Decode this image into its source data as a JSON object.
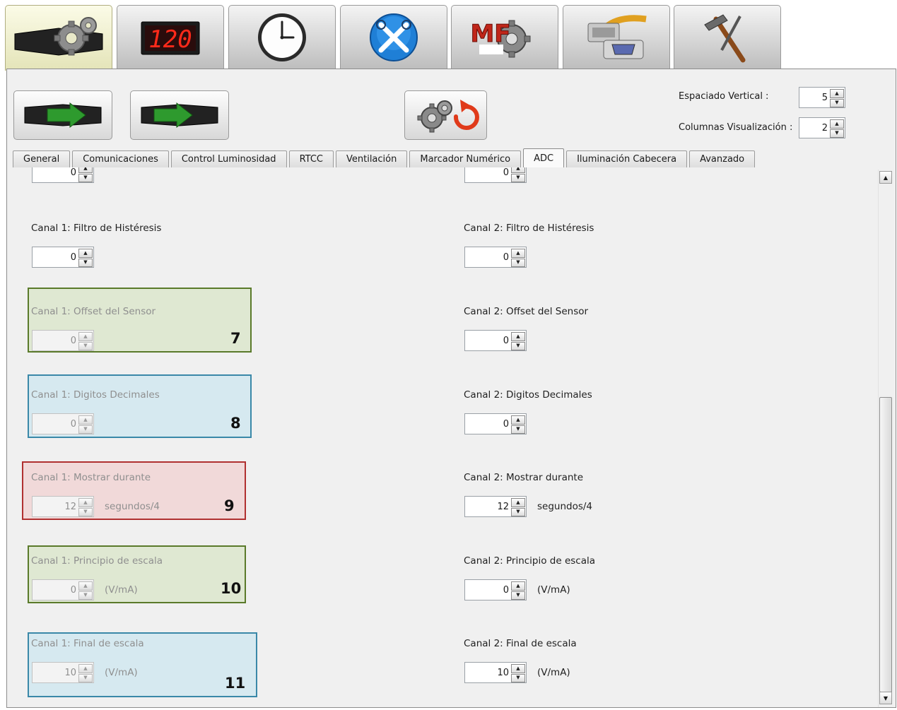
{
  "top_tabs": [
    {
      "name": "display-config",
      "icon": "led-display-gears-icon",
      "active": true
    },
    {
      "name": "numeric-display",
      "icon": "led-counter-icon",
      "readout": "120",
      "active": false
    },
    {
      "name": "clock",
      "icon": "clock-icon",
      "active": false
    },
    {
      "name": "tools",
      "icon": "tools-globe-icon",
      "active": false
    },
    {
      "name": "mf-tools",
      "icon": "mf-tools-icon",
      "readout": "MF",
      "active": false
    },
    {
      "name": "connection",
      "icon": "serial-cable-icon",
      "active": false
    },
    {
      "name": "hammer",
      "icon": "hammer-icon",
      "active": false
    }
  ],
  "toolbar": {
    "buttons": [
      {
        "name": "read-from-device",
        "icon": "display-left-arrow-icon"
      },
      {
        "name": "write-to-device",
        "icon": "display-right-arrow-icon"
      },
      {
        "name": "reset-settings",
        "icon": "gear-reset-icon"
      }
    ],
    "espaciado_vertical": {
      "label": "Espaciado Vertical :",
      "value": "5"
    },
    "columnas_visualizacion": {
      "label": "Columnas Visualización :",
      "value": "2"
    }
  },
  "tabs": [
    {
      "label": "General",
      "active": false
    },
    {
      "label": "Comunicaciones",
      "active": false
    },
    {
      "label": "Control Luminosidad",
      "active": false
    },
    {
      "label": "RTCC",
      "active": false
    },
    {
      "label": "Ventilación",
      "active": false
    },
    {
      "label": "Marcador Numérico",
      "active": false
    },
    {
      "label": "ADC",
      "active": true
    },
    {
      "label": "Iluminación Cabecera",
      "active": false
    },
    {
      "label": "Avanzado",
      "active": false
    }
  ],
  "adc": {
    "top_partial": {
      "c1_value": "0",
      "c2_value": "0"
    },
    "rows": [
      {
        "c1_label": "Canal 1: Filtro de Histéresis",
        "c1_value": "0",
        "c2_label": "Canal 2: Filtro de Histéresis",
        "c2_value": "0",
        "unit": ""
      },
      {
        "c1_label": "Canal 1: Offset del Sensor",
        "c1_value": "0",
        "c2_label": "Canal 2: Offset del Sensor",
        "c2_value": "0",
        "unit": "",
        "badge": "7"
      },
      {
        "c1_label": "Canal 1: Digitos Decimales",
        "c1_value": "0",
        "c2_label": "Canal 2: Digitos Decimales",
        "c2_value": "0",
        "unit": "",
        "badge": "8"
      },
      {
        "c1_label": "Canal 1: Mostrar durante",
        "c1_value": "12",
        "c2_label": "Canal 2: Mostrar durante",
        "c2_value": "12",
        "unit": "segundos/4",
        "badge": "9"
      },
      {
        "c1_label": "Canal 1: Principio de escala",
        "c1_value": "0",
        "c2_label": "Canal 2: Principio de escala",
        "c2_value": "0",
        "unit": "(V/mA)",
        "badge": "10"
      },
      {
        "c1_label": "Canal 1: Final de escala",
        "c1_value": "10",
        "c2_label": "Canal 2: Final de escala",
        "c2_value": "10",
        "unit": "(V/mA)",
        "badge": "11"
      }
    ]
  },
  "colors": {
    "highlight_green": "#5a7a2a",
    "highlight_green_fill": "#dfe8d2",
    "highlight_blue": "#3a88a8",
    "highlight_blue_fill": "#d6e9f0",
    "highlight_red": "#b03030",
    "highlight_red_fill": "#f1d9d9"
  }
}
